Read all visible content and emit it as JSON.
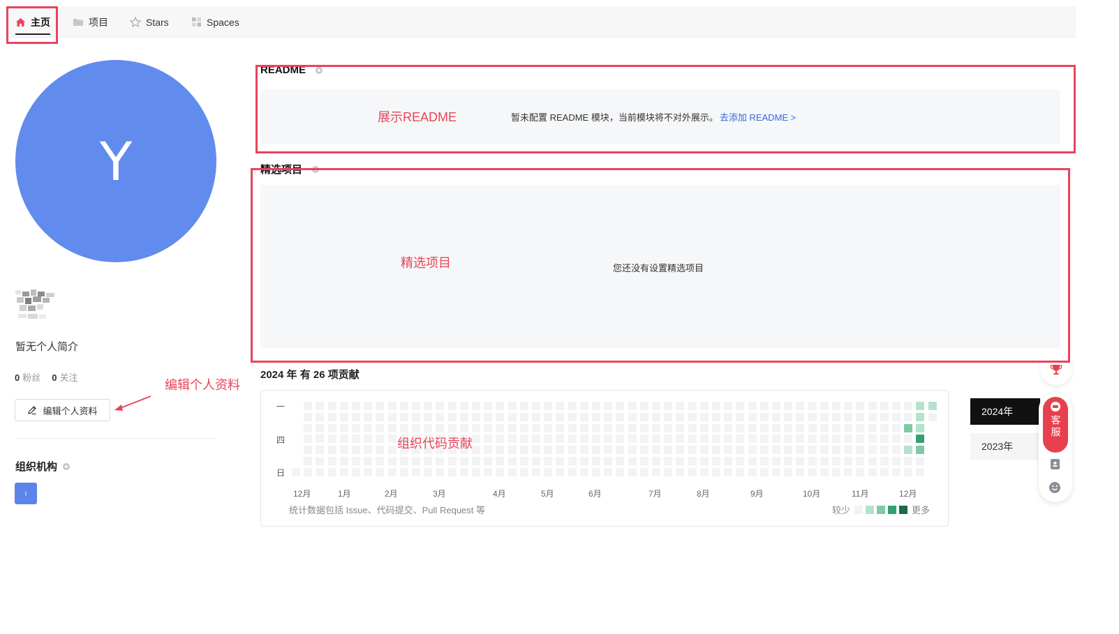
{
  "nav": {
    "tabs": [
      {
        "label": "主页",
        "icon": "home-icon",
        "active": true
      },
      {
        "label": "项目",
        "icon": "folder-icon"
      },
      {
        "label": "Stars",
        "icon": "star-icon"
      },
      {
        "label": "Spaces",
        "icon": "grid-icon"
      }
    ]
  },
  "profile": {
    "avatar_letter": "Y",
    "bio": "暂无个人简介",
    "followers_count": "0",
    "followers_label": "粉丝",
    "following_count": "0",
    "following_label": "关注",
    "edit_label": "编辑个人资料",
    "org_title": "组织机构",
    "org_chip": "I"
  },
  "readme": {
    "title": "README",
    "empty_text": "暂未配置 README 模块，当前模块将不对外展示。",
    "add_link": "去添加 README >"
  },
  "featured": {
    "title": "精选项目",
    "empty_text": "您还没有设置精选项目"
  },
  "contributions": {
    "title": "2024 年 有 26 项贡献",
    "day_labels": [
      "一",
      "四",
      "日"
    ],
    "months": [
      "12月",
      "1月",
      "2月",
      "3月",
      "4月",
      "5月",
      "6月",
      "7月",
      "8月",
      "9月",
      "10月",
      "11月",
      "12月"
    ],
    "footnote": "统计数据包括 Issue、代码提交、Pull Request 等",
    "legend_less": "较少",
    "legend_more": "更多",
    "colors": [
      "#f2f3f4",
      "#b5e2cd",
      "#7fcaa6",
      "#33a06e",
      "#1d6b48"
    ],
    "active_cells": [
      {
        "week": 52,
        "day": 0,
        "level": 1
      },
      {
        "week": 53,
        "day": 0,
        "level": 1
      },
      {
        "week": 52,
        "day": 1,
        "level": 1
      },
      {
        "week": 51,
        "day": 2,
        "level": 2
      },
      {
        "week": 52,
        "day": 2,
        "level": 1
      },
      {
        "week": 52,
        "day": 3,
        "level": 3
      },
      {
        "week": 51,
        "day": 4,
        "level": 1
      },
      {
        "week": 52,
        "day": 4,
        "level": 2
      }
    ]
  },
  "years": [
    "2024年",
    "2023年"
  ],
  "widget": {
    "service_label": "客服"
  },
  "annotations": {
    "readme": "展示README",
    "featured": "精选项目",
    "edit": "编辑个人资料",
    "contrib": "组织代码贡献"
  }
}
